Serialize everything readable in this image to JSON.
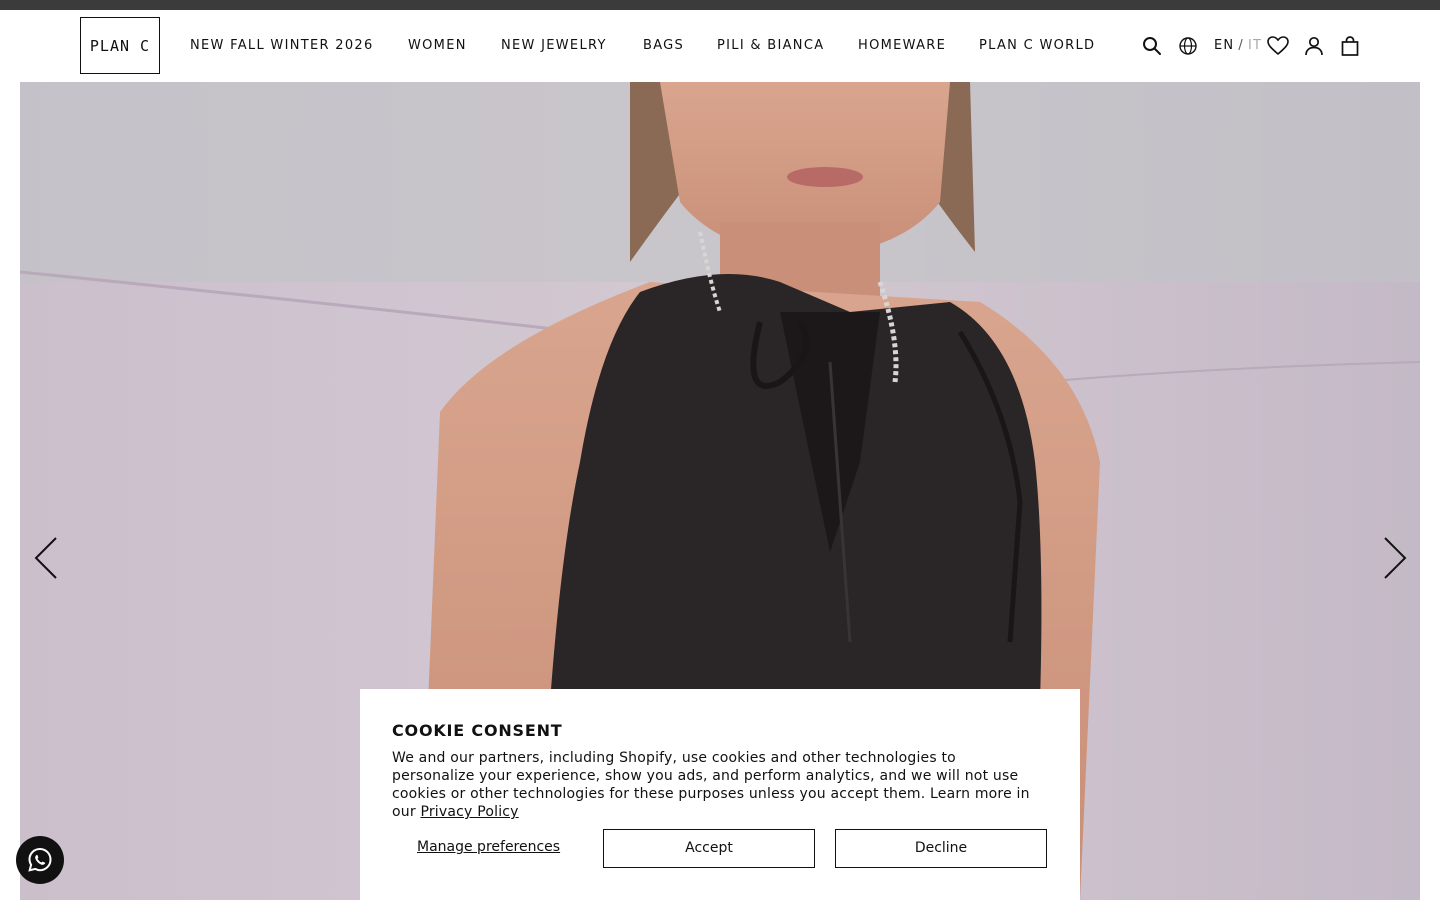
{
  "header": {
    "logo_text": "PLAN C",
    "nav": [
      {
        "label": "NEW FALL WINTER 2026"
      },
      {
        "label": "WOMEN"
      },
      {
        "label": "NEW JEWELRY"
      },
      {
        "label": "BAGS"
      },
      {
        "label": "PILI & BIANCA"
      },
      {
        "label": "HOMEWARE"
      },
      {
        "label": "PLAN C WORLD"
      }
    ],
    "lang_current": "EN",
    "lang_separator": "/",
    "lang_other": "IT",
    "icons": [
      "search-icon",
      "globe-icon",
      "heart-icon",
      "account-icon",
      "bag-icon"
    ]
  },
  "hero": {
    "prev_icon": "chevron-left-icon",
    "next_icon": "chevron-right-icon"
  },
  "whatsapp": {
    "icon": "whatsapp-icon"
  },
  "cookie": {
    "title": "COOKIE CONSENT",
    "body": "We and our partners, including Shopify, use cookies and other technologies to personalize your experience, show you ads, and perform analytics, and we will not use cookies or other technologies for these purposes unless you accept them. Learn more in our",
    "privacy_link": "Privacy Policy",
    "manage_label": "Manage preferences",
    "accept_label": "Accept",
    "decline_label": "Decline"
  },
  "colors": {
    "top_strip": "#3a3b3a",
    "text": "#111111",
    "lang_inactive": "#aaaaaa"
  }
}
